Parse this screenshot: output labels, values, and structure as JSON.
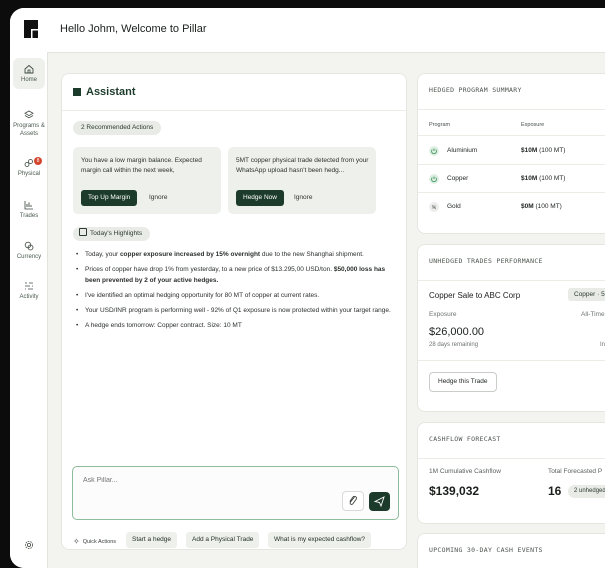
{
  "header": {
    "welcome": "Hello Johm, Welcome to Pillar"
  },
  "sidebar": {
    "items": [
      {
        "label": "Home",
        "icon": "home-icon"
      },
      {
        "label": "Programs & Assets",
        "icon": "stack-icon"
      },
      {
        "label": "Physical",
        "icon": "physical-icon",
        "badge": "8"
      },
      {
        "label": "Trades",
        "icon": "trades-icon"
      },
      {
        "label": "Currency",
        "icon": "currency-icon"
      },
      {
        "label": "Activity",
        "icon": "activity-icon"
      }
    ]
  },
  "assistant": {
    "title": "Assistant",
    "recommended_label": "2 Recommended Actions",
    "actions": [
      {
        "text": "You have a low margin balance. Expected margin call within the next week,",
        "primary": "Top Up Margin",
        "secondary": "Ignore"
      },
      {
        "text": "5MT copper physical trade detected from your WhatsApp upload hasn't been hedg...",
        "primary": "Hedge Now",
        "secondary": "Ignore"
      }
    ],
    "highlights_label": "Today's Highlights",
    "highlights": [
      {
        "pre": "Today, your ",
        "bold": "copper exposure increased by 15% overnight",
        "post": " due to the new Shanghai shipment."
      },
      {
        "pre": "Prices of copper have drop 1% from yesterday, to a new price of $13.295,00 USD/ton. ",
        "bold": "$50,000 loss has been prevented by 2 of your active hedges.",
        "post": ""
      },
      {
        "pre": "I've identified an optimal hedging opportunity for 80 MT of copper at current rates.",
        "bold": "",
        "post": ""
      },
      {
        "pre": "Your USD/INR program is performing well - 92% of Q1 exposure is now protected within your target range.",
        "bold": "",
        "post": ""
      },
      {
        "pre": "A hedge ends tomorrow: Copper contract. Size: 10 MT",
        "bold": "",
        "post": ""
      }
    ],
    "ask_placeholder": "Ask Pillar...",
    "quick_actions_label": "Quick Actions",
    "quick_actions": [
      "Start a hedge",
      "Add a Physical Trade",
      "What is my expected cashflow?"
    ]
  },
  "hedged_summary": {
    "title": "HEDGED PROGRAM SUMMARY",
    "columns": [
      "Program",
      "Exposure"
    ],
    "rows": [
      {
        "program": "Aluminium",
        "exposure": "$10M",
        "unit": "(100 MT)",
        "icon": "power-icon",
        "color": "#2f8a4c"
      },
      {
        "program": "Copper",
        "exposure": "$10M",
        "unit": "(100 MT)",
        "icon": "power-icon",
        "color": "#2f8a4c"
      },
      {
        "program": "Gold",
        "exposure": "$0M",
        "unit": "(100 MT)",
        "icon": "pause-icon",
        "color": "#8a8f8b"
      }
    ]
  },
  "unhedged": {
    "title": "UNHEDGED TRADES PERFORMANCE",
    "trade_name": "Copper Sale to ABC Corp",
    "tag": "Copper · 5",
    "exposure_label": "Exposure",
    "alltime_label": "All-Time",
    "value": "$26,000.00",
    "remaining": "28 days remaining",
    "right_sub": "In",
    "button": "Hedge this Trade"
  },
  "cashflow": {
    "title": "CASHFLOW FORECAST",
    "left_label": "1M Cumulative Cashflow",
    "left_value": "$139,032",
    "right_label": "Total Forecasted P",
    "right_value": "16",
    "pill": "2 unhedged"
  },
  "upcoming": {
    "title": "UPCOMING 30-DAY CASH EVENTS"
  },
  "colors": {
    "brand": "#1c3b2a",
    "accent_green": "#2f8a4c",
    "badge_red": "#d4442c"
  }
}
